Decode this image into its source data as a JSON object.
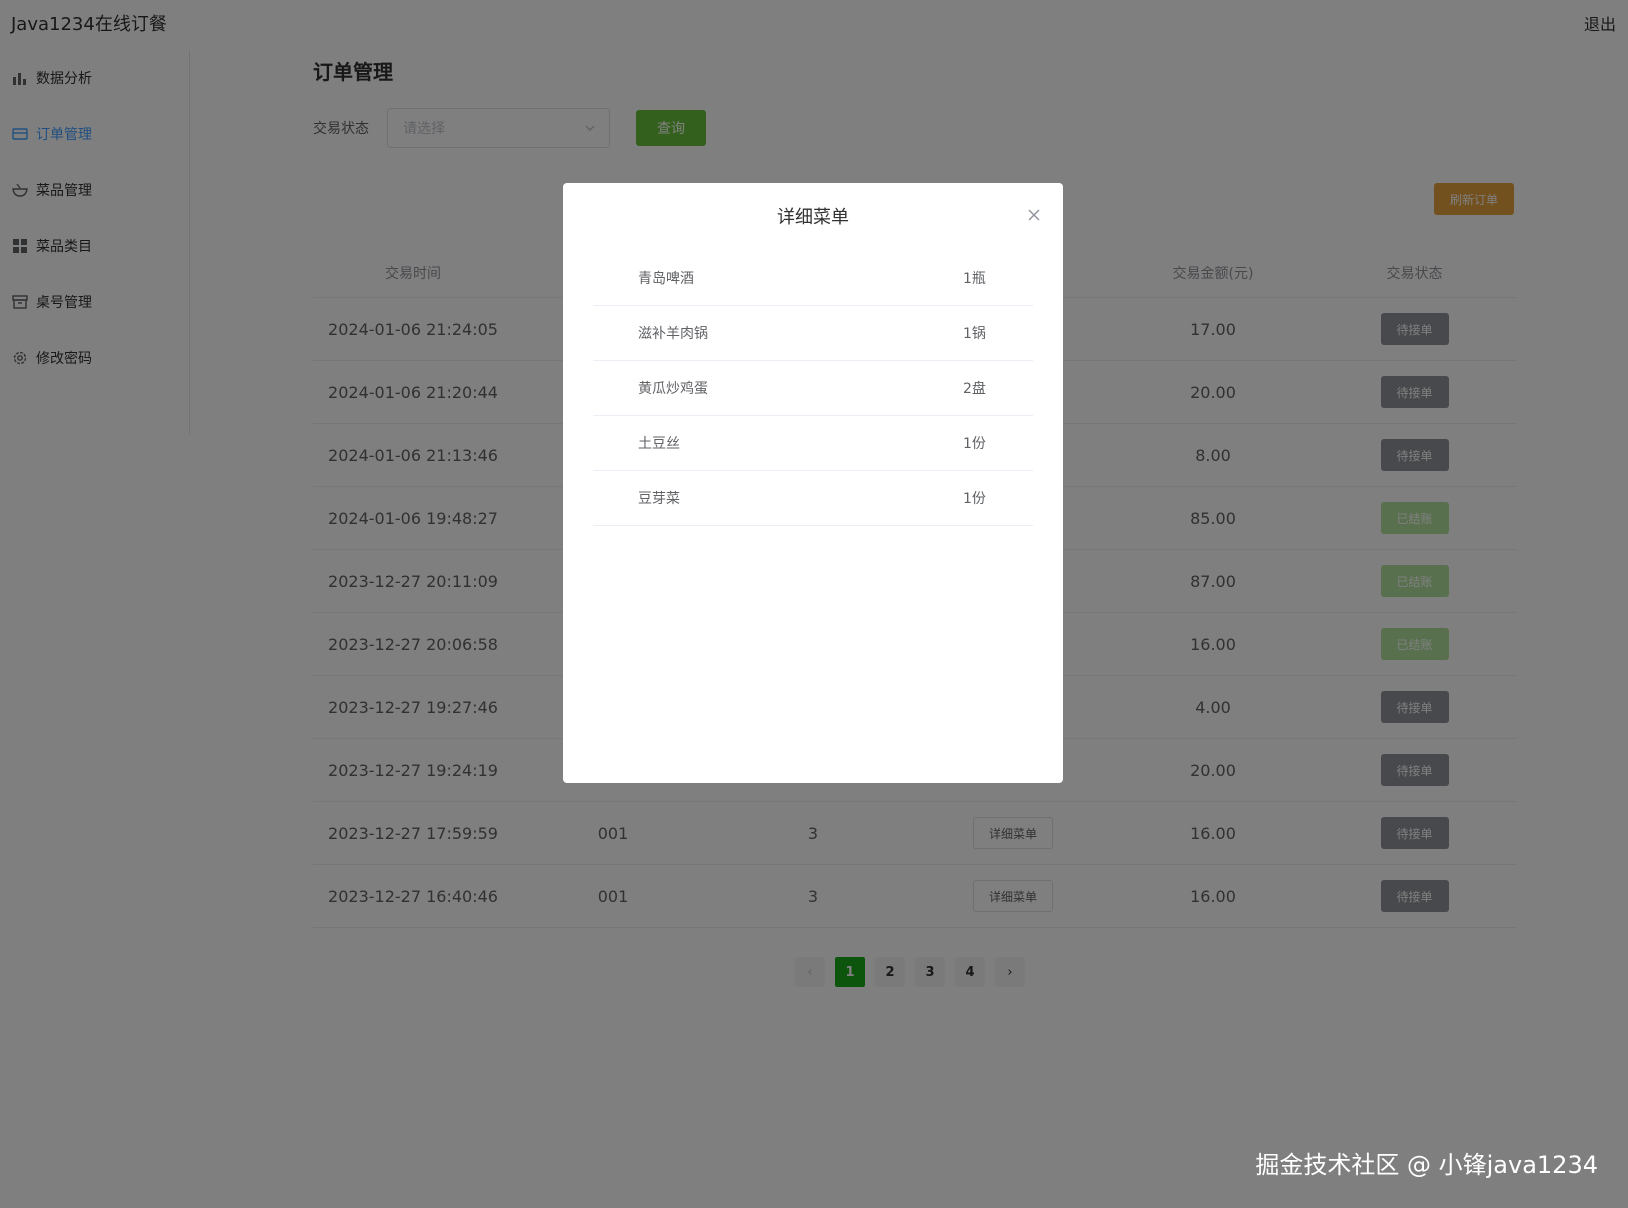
{
  "app_title": "Java1234在线订餐",
  "logout": "退出",
  "sidebar": {
    "items": [
      {
        "label": "数据分析",
        "icon": "bar-chart-icon"
      },
      {
        "label": "订单管理",
        "icon": "card-icon",
        "active": true
      },
      {
        "label": "菜品管理",
        "icon": "bowl-icon"
      },
      {
        "label": "菜品类目",
        "icon": "grid-icon"
      },
      {
        "label": "桌号管理",
        "icon": "box-icon"
      },
      {
        "label": "修改密码",
        "icon": "gear-icon"
      }
    ]
  },
  "main": {
    "title": "订单管理",
    "filter_label": "交易状态",
    "select_placeholder": "请选择",
    "query_label": "查询",
    "refresh_label": "刷新订单"
  },
  "table": {
    "headers": [
      "交易时间",
      "",
      "",
      "",
      "交易金额(元)",
      "交易状态"
    ],
    "detail_label": "详细菜单",
    "rows": [
      {
        "time": "2024-01-06 21:24:05",
        "table_no": "",
        "people": "",
        "amount": "17.00",
        "status": "待接单",
        "status_type": "pending"
      },
      {
        "time": "2024-01-06 21:20:44",
        "table_no": "",
        "people": "",
        "amount": "20.00",
        "status": "待接单",
        "status_type": "pending"
      },
      {
        "time": "2024-01-06 21:13:46",
        "table_no": "",
        "people": "",
        "amount": "8.00",
        "status": "待接单",
        "status_type": "pending"
      },
      {
        "time": "2024-01-06 19:48:27",
        "table_no": "",
        "people": "",
        "amount": "85.00",
        "status": "已结账",
        "status_type": "done"
      },
      {
        "time": "2023-12-27 20:11:09",
        "table_no": "",
        "people": "",
        "amount": "87.00",
        "status": "已结账",
        "status_type": "done"
      },
      {
        "time": "2023-12-27 20:06:58",
        "table_no": "",
        "people": "",
        "amount": "16.00",
        "status": "已结账",
        "status_type": "done"
      },
      {
        "time": "2023-12-27 19:27:46",
        "table_no": "",
        "people": "",
        "amount": "4.00",
        "status": "待接单",
        "status_type": "pending"
      },
      {
        "time": "2023-12-27 19:24:19",
        "table_no": "",
        "people": "",
        "amount": "20.00",
        "status": "待接单",
        "status_type": "pending"
      },
      {
        "time": "2023-12-27 17:59:59",
        "table_no": "001",
        "people": "3",
        "amount": "16.00",
        "status": "待接单",
        "status_type": "pending"
      },
      {
        "time": "2023-12-27 16:40:46",
        "table_no": "001",
        "people": "3",
        "amount": "16.00",
        "status": "待接单",
        "status_type": "pending"
      }
    ]
  },
  "pagination": {
    "pages": [
      "1",
      "2",
      "3",
      "4"
    ],
    "current": "1"
  },
  "modal": {
    "title": "详细菜单",
    "items": [
      {
        "name": "青岛啤酒",
        "qty": "1瓶"
      },
      {
        "name": "滋补羊肉锅",
        "qty": "1锅"
      },
      {
        "name": "黄瓜炒鸡蛋",
        "qty": "2盘"
      },
      {
        "name": "土豆丝",
        "qty": "1份"
      },
      {
        "name": "豆芽菜",
        "qty": "1份"
      }
    ]
  },
  "watermark": "掘金技术社区 @ 小锋java1234",
  "colors": {
    "accent": "#409eff",
    "success": "#67c23a",
    "warning": "#e6a23c",
    "info": "#909399",
    "page_active": "#1aaa1a"
  }
}
